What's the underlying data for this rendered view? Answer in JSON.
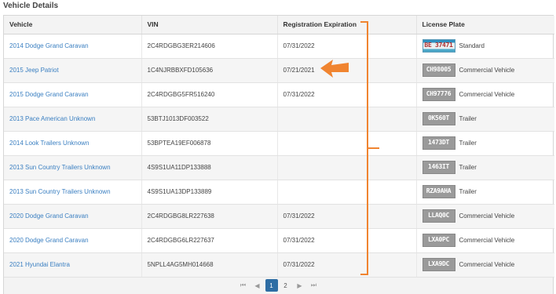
{
  "section": {
    "title": "Vehicle Details"
  },
  "table": {
    "headers": {
      "vehicle": "Vehicle",
      "vin": "VIN",
      "registration": "Registration Expiration",
      "plate": "License Plate"
    },
    "rows": [
      {
        "vehicle": "2014 Dodge Grand Caravan",
        "vin": "2C4RDGBG3ER214606",
        "registration": "07/31/2022",
        "plate": "BE 37471",
        "plate_type": "Standard"
      },
      {
        "vehicle": "2015 Jeep Patriot",
        "vin": "1C4NJRBBXFD105636",
        "registration": "07/21/2021",
        "plate": "CH98005",
        "plate_type": "Commercial Vehicle"
      },
      {
        "vehicle": "2015 Dodge Grand Caravan",
        "vin": "2C4RDGBG5FR516240",
        "registration": "07/31/2022",
        "plate": "CH97776",
        "plate_type": "Commercial Vehicle"
      },
      {
        "vehicle": "2013 Pace American Unknown",
        "vin": "53BTJ1013DF003522",
        "registration": "",
        "plate": "0K560T",
        "plate_type": "Trailer"
      },
      {
        "vehicle": "2014 Look Trailers Unknown",
        "vin": "53BPTEA19EF006878",
        "registration": "",
        "plate": "1473DT",
        "plate_type": "Trailer"
      },
      {
        "vehicle": "2013 Sun Country Trailers Unknown",
        "vin": "4S9S1UA11DP133888",
        "registration": "",
        "plate": "1463IT",
        "plate_type": "Trailer"
      },
      {
        "vehicle": "2013 Sun Country Trailers Unknown",
        "vin": "4S9S1UA13DP133889",
        "registration": "",
        "plate": "RZA9AHA",
        "plate_type": "Trailer"
      },
      {
        "vehicle": "2020 Dodge Grand Caravan",
        "vin": "2C4RDGBG8LR227638",
        "registration": "07/31/2022",
        "plate": "LLAQ0C",
        "plate_type": "Commercial Vehicle"
      },
      {
        "vehicle": "2020 Dodge Grand Caravan",
        "vin": "2C4RDGBG6LR227637",
        "registration": "07/31/2022",
        "plate": "LXA0PC",
        "plate_type": "Commercial Vehicle"
      },
      {
        "vehicle": "2021 Hyundai Elantra",
        "vin": "5NPLL4AG5MH014668",
        "registration": "07/31/2022",
        "plate": "LXA9DC",
        "plate_type": "Commercial Vehicle"
      }
    ]
  },
  "pager": {
    "first": "⏮",
    "prev": "◀",
    "page1": "1",
    "page2": "2",
    "next": "▶",
    "last": "⏭",
    "current_page": 1
  },
  "annotation": {
    "color": "#f08430"
  }
}
